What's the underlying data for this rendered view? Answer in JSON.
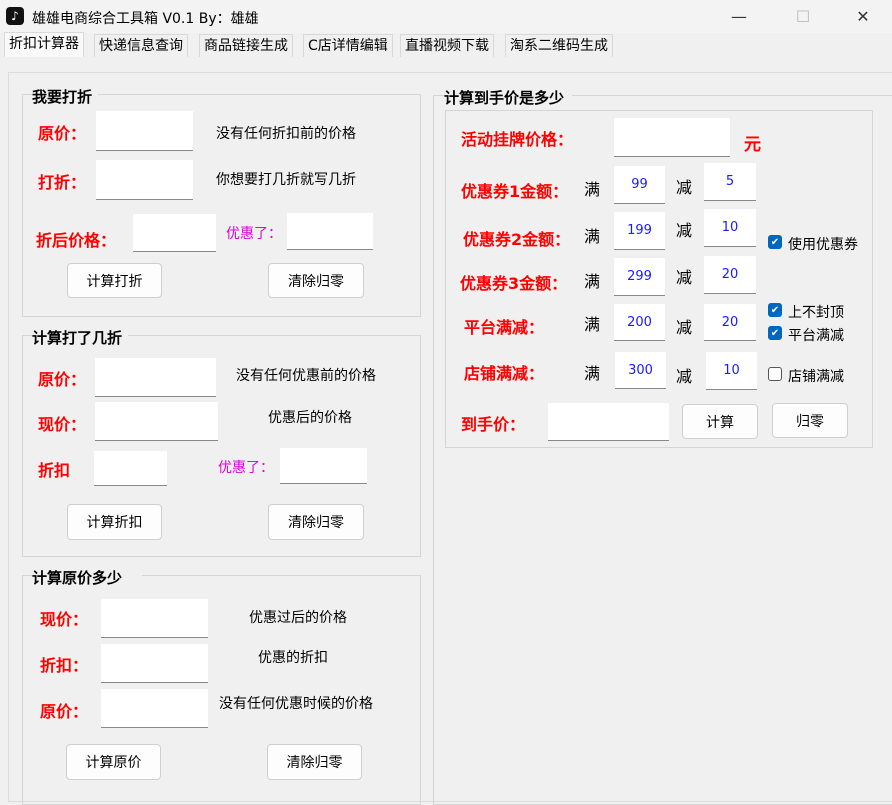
{
  "window": {
    "title": "雄雄电商综合工具箱 V0.1   By：雄雄",
    "minimize": "—",
    "maximize": "☐",
    "close": "✕"
  },
  "tabs": [
    "折扣计算器",
    "快递信息查询",
    "商品链接生成",
    "C店详情编辑",
    "直播视频下载",
    "淘系二维码生成"
  ],
  "g1": {
    "title": "我要打折",
    "l1": "原价：",
    "h1": "没有任何折扣前的价格",
    "l2": "打折：",
    "h2": "你想要打几折就写几折",
    "l3": "折后价格：",
    "l4": "优惠了：",
    "b1": "计算打折",
    "b2": "清除归零"
  },
  "g2": {
    "title": "计算打了几折",
    "l1": "原价：",
    "h1": "没有任何优惠前的价格",
    "l2": "现价：",
    "h2": "优惠后的价格",
    "l3": "折扣",
    "l4": "优惠了：",
    "b1": "计算折扣",
    "b2": "清除归零"
  },
  "g3": {
    "title": "计算原价多少",
    "l1": "现价：",
    "h1": "优惠过后的价格",
    "l2": "折扣：",
    "h2": "优惠的折扣",
    "l3": "原价：",
    "h3": "没有任何优惠时候的价格",
    "b1": "计算原价",
    "b2": "清除归零"
  },
  "g4": {
    "title": "计算到手价是多少",
    "list_price": "活动挂牌价格：",
    "yuan": "元",
    "man": "满",
    "jian": "减",
    "c1": "优惠券1金额：",
    "c1_min": "99",
    "c1_off": "5",
    "c2": "优惠券2金额：",
    "c2_min": "199",
    "c2_off": "10",
    "c3": "优惠券3金额：",
    "c3_min": "299",
    "c3_off": "20",
    "plat": "平台满减：",
    "plat_min": "200",
    "plat_off": "20",
    "shop": "店铺满减：",
    "shop_min": "300",
    "shop_off": "10",
    "use_coupon": "使用优惠券",
    "no_cap": "上不封顶",
    "plat_cb": "平台满减",
    "shop_cb": "店铺满减",
    "final": "到手价：",
    "calc": "计算",
    "reset": "归零"
  },
  "checkboxes": {
    "use_coupon": true,
    "no_cap": true,
    "plat": true,
    "shop": false
  }
}
